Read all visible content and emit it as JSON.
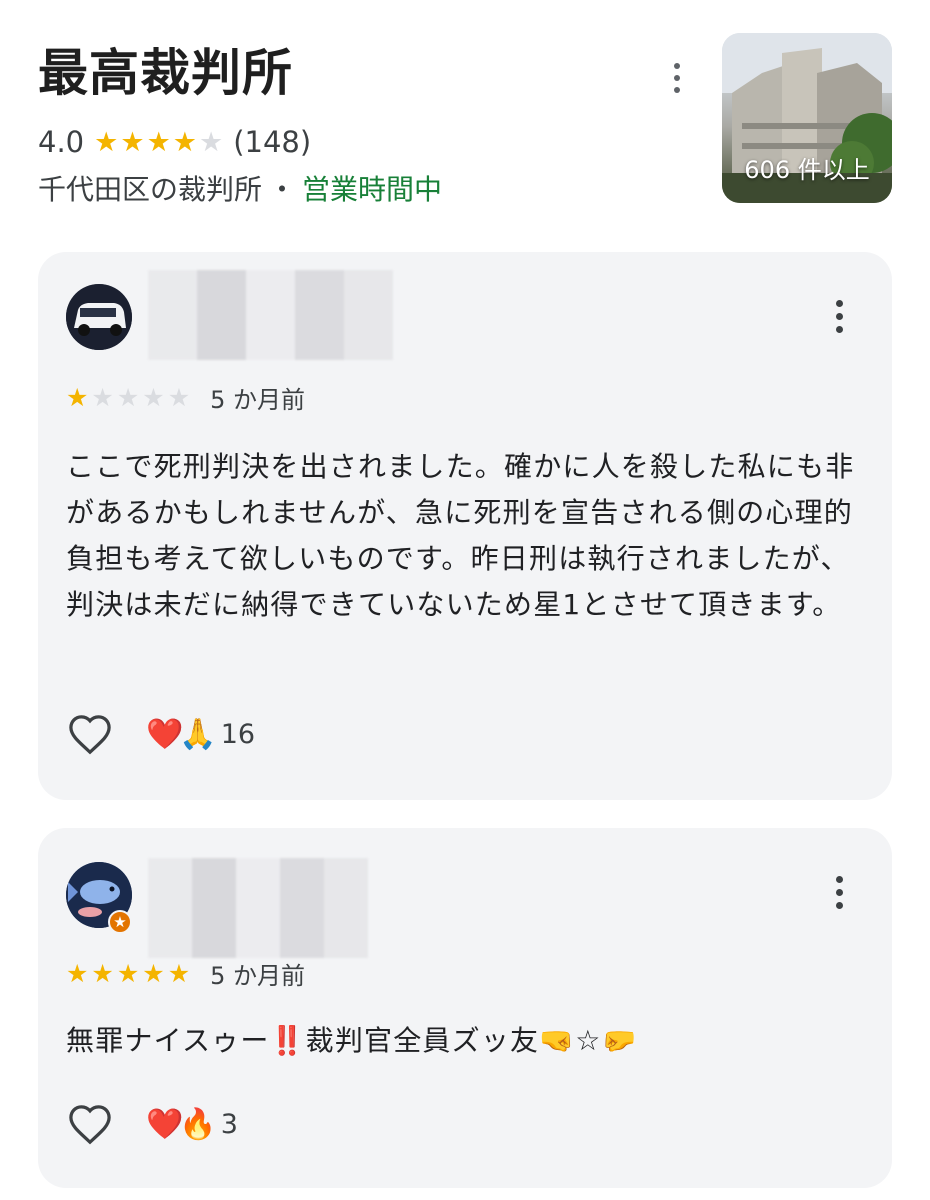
{
  "place": {
    "title": "最高裁判所",
    "rating": "4.0",
    "rating_stars": 4,
    "review_count": "(148)",
    "category": "千代田区の裁判所",
    "separator": "・",
    "status": "営業時間中",
    "photo_count": "606 件以上",
    "colors": {
      "status": "#188038",
      "star": "#f4b400"
    }
  },
  "reviews": [
    {
      "stars": 1,
      "time": "5 か月前",
      "text": "ここで死刑判決を出されました。確かに人を殺した私にも非があるかもしれませんが、急に死刑を宣告される側の心理的負担も考えて欲しいものです。昨日刑は執行されましたが、判決は未だに納得できていないため星1とさせて頂きます。",
      "reaction_emojis": "❤️🙏",
      "reaction_count": "16"
    },
    {
      "stars": 5,
      "time": "5 か月前",
      "text": "無罪ナイスゥー‼️裁判官全員ズッ友🤜☆🤛",
      "reaction_emojis": "❤️🔥",
      "reaction_count": "3"
    }
  ],
  "icons": {
    "more": "more-vert-icon",
    "like": "heart-outline-icon",
    "star": "star-icon",
    "local_guide": "local-guide-badge-icon"
  }
}
